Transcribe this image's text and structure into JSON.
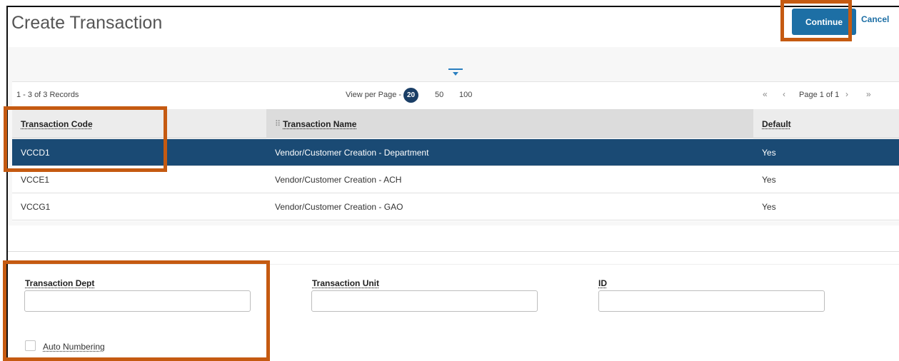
{
  "header": {
    "title": "Create Transaction",
    "continue_label": "Continue",
    "cancel_label": "Cancel"
  },
  "pager": {
    "records_text": "1 - 3 of 3 Records",
    "view_per_page_label": "View per Page -",
    "page_sizes": [
      "20",
      "50",
      "100"
    ],
    "selected_page_size": "20",
    "page_info": "Page 1 of 1",
    "first_icon": "«",
    "prev_icon": "‹",
    "next_icon": "›",
    "last_icon": "»"
  },
  "table": {
    "columns": [
      "Transaction Code",
      "Transaction Name",
      "Default"
    ],
    "rows": [
      {
        "code": "VCCD1",
        "name": "Vendor/Customer Creation - Department",
        "default": "Yes",
        "selected": true
      },
      {
        "code": "VCCE1",
        "name": "Vendor/Customer Creation - ACH",
        "default": "Yes",
        "selected": false
      },
      {
        "code": "VCCG1",
        "name": "Vendor/Customer Creation - GAO",
        "default": "Yes",
        "selected": false
      }
    ]
  },
  "form": {
    "dept_label": "Transaction Dept",
    "dept_value": "",
    "unit_label": "Transaction Unit",
    "unit_value": "",
    "id_label": "ID",
    "id_value": "",
    "auto_numbering_label": "Auto Numbering",
    "auto_numbering_checked": false
  },
  "colors": {
    "primary": "#1d6fa5",
    "selected_row": "#1a4a74",
    "highlight": "#c55a11"
  }
}
